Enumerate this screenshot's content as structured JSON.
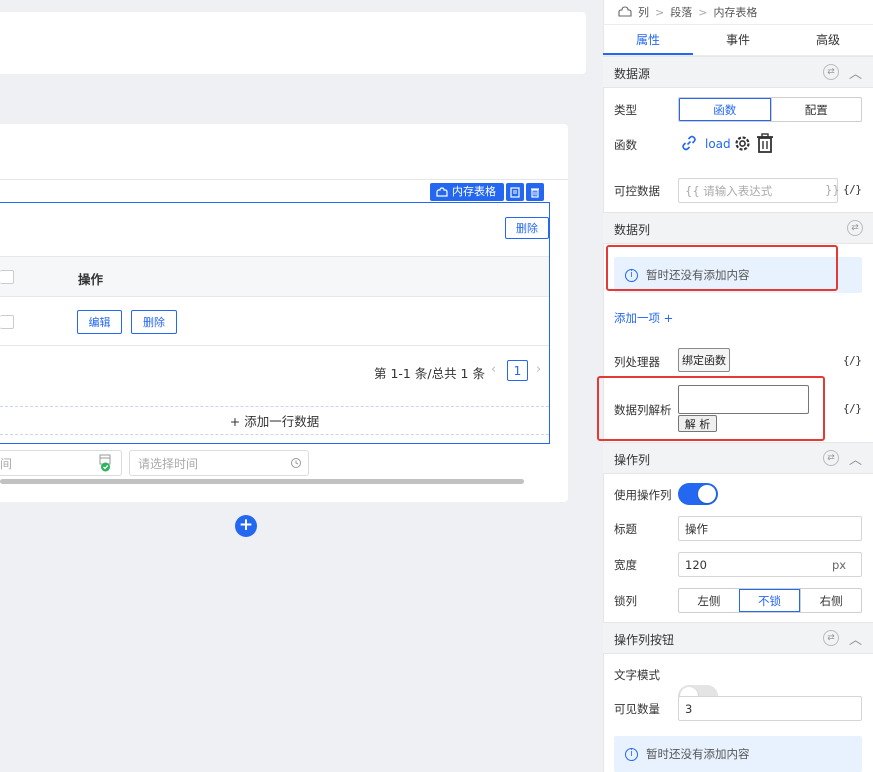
{
  "canvas": {
    "selection_tag": "内存表格",
    "delete_top_button": "删除",
    "table": {
      "header_action": "操作",
      "row_edit": "编辑",
      "row_delete": "删除"
    },
    "pager": {
      "summary": "第 1-1 条/总共 1 条",
      "current_page": "1",
      "prev": "‹",
      "next": "›"
    },
    "add_row": "+  添加一行数据",
    "date_placeholder_partial": "间",
    "time_placeholder": "请选择时间",
    "add_component": "+"
  },
  "panel": {
    "breadcrumb": [
      "列",
      "段落",
      "内存表格"
    ],
    "tabs": [
      "属性",
      "事件",
      "高级"
    ],
    "active_tab": "属性",
    "datasource": {
      "title": "数据源",
      "type_label": "类型",
      "type_options": [
        "函数",
        "配置"
      ],
      "type_selected": "函数",
      "func_label": "函数",
      "func_name": "load",
      "controlled_label": "可控数据",
      "controlled_placeholder": "{{ 请输入表达式",
      "controlled_suffix": "}}",
      "fx": "{/}"
    },
    "datacols": {
      "title": "数据列",
      "empty_info": "暂时还没有添加内容",
      "add_item": "添加一项 +",
      "handler_label": "列处理器",
      "handler_button": "绑定函数",
      "parse_label": "数据列解析",
      "parse_button": "解 析",
      "fx": "{/}"
    },
    "action_col": {
      "title": "操作列",
      "use_label": "使用操作列",
      "use_on": true,
      "title_label": "标题",
      "title_value": "操作",
      "width_label": "宽度",
      "width_value": "120",
      "width_unit": "px",
      "lock_label": "锁列",
      "lock_options": [
        "左侧",
        "不锁",
        "右侧"
      ],
      "lock_selected": "不锁"
    },
    "action_buttons": {
      "title": "操作列按钮",
      "text_mode_label": "文字模式",
      "text_mode_on": false,
      "visible_count_label": "可见数量",
      "visible_count_value": "3",
      "empty_info": "暂时还没有添加内容"
    }
  },
  "colors": {
    "accent": "#2468f2",
    "highlight_box": "#e53935",
    "info_bg": "#e8f2ff"
  }
}
